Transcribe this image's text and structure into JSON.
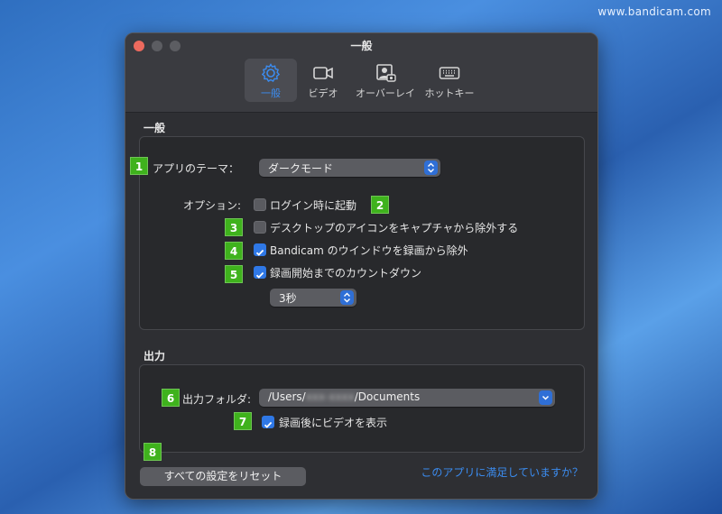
{
  "watermark": "www.bandicam.com",
  "window": {
    "title": "一般"
  },
  "tabs": [
    {
      "label": "一般",
      "icon": "gear-icon",
      "active": true
    },
    {
      "label": "ビデオ",
      "icon": "video-camera-icon",
      "active": false
    },
    {
      "label": "オーバーレイ",
      "icon": "webcam-overlay-icon",
      "active": false
    },
    {
      "label": "ホットキー",
      "icon": "keyboard-icon",
      "active": false
    }
  ],
  "general": {
    "section_title": "一般",
    "theme_label": "アプリのテーマ：",
    "theme_value": "ダークモード",
    "options_label": "オプション:",
    "options": [
      {
        "label": "ログイン時に起動",
        "checked": false
      },
      {
        "label": "デスクトップのアイコンをキャプチャから除外する",
        "checked": false
      },
      {
        "label": "Bandicam のウインドウを録画から除外",
        "checked": true
      },
      {
        "label": "録画開始までのカウントダウン",
        "checked": true
      }
    ],
    "countdown_value": "3秒"
  },
  "output": {
    "section_title": "出力",
    "folder_label": "出力フォルダ:",
    "folder_prefix": "/Users/",
    "folder_user": "xxx-xxxx",
    "folder_suffix": "/Documents",
    "show_video_label": "録画後にビデオを表示",
    "show_video_checked": true
  },
  "reset_button": "すべての設定をリセット",
  "feedback_link": "このアプリに満足していますか？",
  "badges": [
    "1",
    "2",
    "3",
    "4",
    "5",
    "6",
    "7",
    "8"
  ],
  "colors": {
    "accent": "#3b8cf0",
    "badge": "#3fb21d",
    "checkbox_on": "#2f78e6"
  }
}
